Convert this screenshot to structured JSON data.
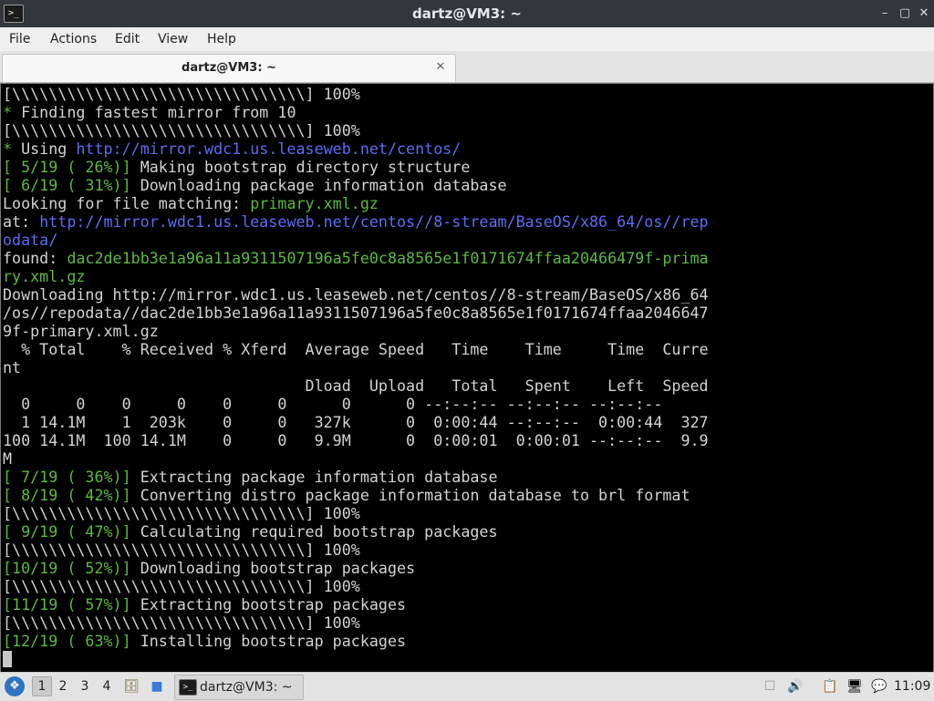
{
  "window": {
    "title": "dartz@VM3: ~",
    "app_icon": ">_",
    "controls": {
      "minimize": "–",
      "maximize": "▢",
      "close": "✕"
    }
  },
  "menu": [
    "File",
    "Actions",
    "Edit",
    "View",
    "Help"
  ],
  "tab": {
    "label": "dartz@VM3: ~",
    "close": "✕"
  },
  "colors": {
    "green": "#5dba3c",
    "blue": "#5f6bf2",
    "text": "#d3d3d3",
    "background": "#000000"
  },
  "terminal": {
    "lines": [
      [
        {
          "t": "[\\\\\\\\\\\\\\\\\\\\\\\\\\\\\\\\\\\\\\\\\\\\\\\\\\\\\\\\\\\\\\\\] 100%"
        }
      ],
      [
        {
          "t": "* ",
          "c": "g"
        },
        {
          "t": "Finding fastest mirror from 10"
        }
      ],
      [
        {
          "t": "[\\\\\\\\\\\\\\\\\\\\\\\\\\\\\\\\\\\\\\\\\\\\\\\\\\\\\\\\\\\\\\\\] 100%"
        }
      ],
      [
        {
          "t": "* ",
          "c": "g"
        },
        {
          "t": "Using "
        },
        {
          "t": "http://mirror.wdc1.us.leaseweb.net/centos/",
          "c": "b"
        }
      ],
      [
        {
          "t": "[ 5/19 ( 26%)] ",
          "c": "g"
        },
        {
          "t": "Making bootstrap directory structure"
        }
      ],
      [
        {
          "t": "[ 6/19 ( 31%)] ",
          "c": "g"
        },
        {
          "t": "Downloading package information database"
        }
      ],
      [
        {
          "t": "Looking for file matching: "
        },
        {
          "t": "primary.xml.gz",
          "c": "g"
        }
      ],
      [
        {
          "t": "at: "
        },
        {
          "t": "http://mirror.wdc1.us.leaseweb.net/centos//8-stream/BaseOS/x86_64/os//rep",
          "c": "b"
        }
      ],
      [
        {
          "t": "odata/",
          "c": "b"
        }
      ],
      [
        {
          "t": "found: "
        },
        {
          "t": "dac2de1bb3e1a96a11a9311507196a5fe0c8a8565e1f0171674ffaa20466479f-prima",
          "c": "g"
        }
      ],
      [
        {
          "t": "ry.xml.gz",
          "c": "g"
        }
      ],
      [
        {
          "t": "Downloading http://mirror.wdc1.us.leaseweb.net/centos//8-stream/BaseOS/x86_64"
        }
      ],
      [
        {
          "t": "/os//repodata//dac2de1bb3e1a96a11a9311507196a5fe0c8a8565e1f0171674ffaa2046647"
        }
      ],
      [
        {
          "t": "9f-primary.xml.gz"
        }
      ],
      [
        {
          "t": "  % Total    % Received % Xferd  Average Speed   Time    Time     Time  Curre"
        }
      ],
      [
        {
          "t": "nt"
        }
      ],
      [
        {
          "t": "                                 Dload  Upload   Total   Spent    Left  Speed"
        }
      ],
      [
        {
          "t": "  0     0    0     0    0     0      0      0 --:--:-- --:--:-- --:--:--"
        }
      ],
      [
        {
          "t": "  1 14.1M    1  203k    0     0   327k      0  0:00:44 --:--:--  0:00:44  327"
        }
      ],
      [
        {
          "t": "100 14.1M  100 14.1M    0     0   9.9M      0  0:00:01  0:00:01 --:--:--  9.9"
        }
      ],
      [
        {
          "t": "M"
        }
      ],
      [
        {
          "t": "[ 7/19 ( 36%)] ",
          "c": "g"
        },
        {
          "t": "Extracting package information database"
        }
      ],
      [
        {
          "t": "[ 8/19 ( 42%)] ",
          "c": "g"
        },
        {
          "t": "Converting distro package information database to brl format"
        }
      ],
      [
        {
          "t": "[\\\\\\\\\\\\\\\\\\\\\\\\\\\\\\\\\\\\\\\\\\\\\\\\\\\\\\\\\\\\\\\\] 100%"
        }
      ],
      [
        {
          "t": "[ 9/19 ( 47%)] ",
          "c": "g"
        },
        {
          "t": "Calculating required bootstrap packages"
        }
      ],
      [
        {
          "t": "[\\\\\\\\\\\\\\\\\\\\\\\\\\\\\\\\\\\\\\\\\\\\\\\\\\\\\\\\\\\\\\\\] 100%"
        }
      ],
      [
        {
          "t": "[10/19 ( 52%)] ",
          "c": "g"
        },
        {
          "t": "Downloading bootstrap packages"
        }
      ],
      [
        {
          "t": "[\\\\\\\\\\\\\\\\\\\\\\\\\\\\\\\\\\\\\\\\\\\\\\\\\\\\\\\\\\\\\\\\] 100%"
        }
      ],
      [
        {
          "t": "[11/19 ( 57%)] ",
          "c": "g"
        },
        {
          "t": "Extracting bootstrap packages"
        }
      ],
      [
        {
          "t": "[\\\\\\\\\\\\\\\\\\\\\\\\\\\\\\\\\\\\\\\\\\\\\\\\\\\\\\\\\\\\\\\\] 100%"
        }
      ],
      [
        {
          "t": "[12/19 ( 63%)] ",
          "c": "g"
        },
        {
          "t": "Installing bootstrap packages"
        }
      ]
    ]
  },
  "taskbar": {
    "start_icon": "❖",
    "workspaces": [
      "1",
      "2",
      "3",
      "4"
    ],
    "task_label": "dartz@VM3: ~",
    "task_icon": ">_",
    "tray": {
      "volume": "🔊",
      "clipboard": "📋",
      "network": "🖥",
      "notify": "💬",
      "placeholder": "☐",
      "files": "🗄",
      "desktop": "■"
    },
    "clock": "11:09"
  }
}
